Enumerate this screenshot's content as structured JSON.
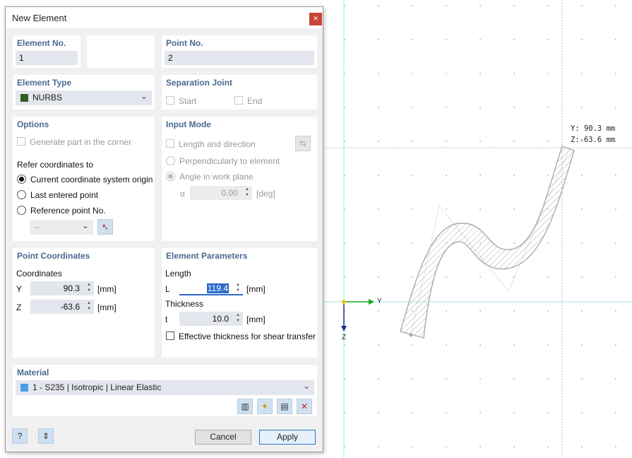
{
  "dialog": {
    "title": "New Element",
    "close_label": "×",
    "element_no": {
      "label": "Element No.",
      "value": "1"
    },
    "point_no": {
      "label": "Point No.",
      "value": "2"
    },
    "element_type": {
      "label": "Element Type",
      "value": "NURBS",
      "color": "#2e5d1e"
    },
    "separation_joint": {
      "label": "Separation Joint",
      "start": "Start",
      "end": "End"
    },
    "options": {
      "label": "Options",
      "generate_part": "Generate part in the corner",
      "refer_label": "Refer coordinates to",
      "refer_options": [
        "Current coordinate system origin",
        "Last entered point",
        "Reference point No."
      ],
      "ref_point_value": "--"
    },
    "input_mode": {
      "label": "Input Mode",
      "length_dir": "Length and direction",
      "perpendicular": "Perpendicularly to element",
      "angle_plane": "Angle in work plane",
      "alpha_symbol": "α",
      "alpha_value": "0.00",
      "alpha_unit": "[deg]"
    },
    "point_coordinates": {
      "label": "Point Coordinates",
      "coords_label": "Coordinates",
      "y_label": "Y",
      "y_value": "90.3",
      "y_unit": "[mm]",
      "z_label": "Z",
      "z_value": "-63.6",
      "z_unit": "[mm]"
    },
    "element_params": {
      "label": "Element Parameters",
      "length_label": "Length",
      "l_label": "L",
      "l_value": "119.4",
      "l_unit": "[mm]",
      "thickness_label": "Thickness",
      "t_label": "t",
      "t_value": "10.0",
      "t_unit": "[mm]",
      "effective_label": "Effective thickness for shear transfer"
    },
    "material": {
      "label": "Material",
      "value": "1 - S235 | Isotropic | Linear Elastic",
      "color": "#4a9be8"
    },
    "buttons": {
      "cancel": "Cancel",
      "apply": "Apply"
    }
  },
  "canvas": {
    "readout_y": "Y: 90.3 mm",
    "readout_z": "Z:-63.6 mm",
    "axis_y": "Y",
    "axis_z": "Z"
  }
}
